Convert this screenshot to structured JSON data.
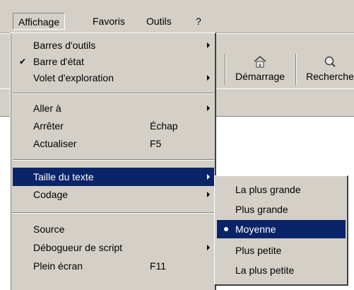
{
  "menubar": {
    "items": [
      {
        "label": "Affichage",
        "active": true
      },
      {
        "label": "Favoris"
      },
      {
        "label": "Outils"
      },
      {
        "label": "?"
      }
    ]
  },
  "toolbar": {
    "home_label": "Démarrage",
    "search_label": "Recherche",
    "home_icon": "home-icon",
    "search_icon": "search-icon"
  },
  "view_menu": {
    "items": [
      {
        "label": "Barres d'outils",
        "submenu": true
      },
      {
        "label": "Barre d'état",
        "checked": true
      },
      {
        "label": "Volet d'exploration",
        "submenu": true
      },
      {
        "label": "Aller à",
        "submenu": true
      },
      {
        "label": "Arrêter",
        "shortcut": "Échap"
      },
      {
        "label": "Actualiser",
        "shortcut": "F5"
      },
      {
        "label": "Taille du texte",
        "submenu": true,
        "highlighted": true
      },
      {
        "label": "Codage",
        "submenu": true
      },
      {
        "label": "Source"
      },
      {
        "label": "Débogueur de script",
        "submenu": true
      },
      {
        "label": "Plein écran",
        "shortcut": "F11"
      }
    ]
  },
  "text_size_submenu": {
    "items": [
      {
        "label": "La plus grande"
      },
      {
        "label": "Plus grande"
      },
      {
        "label": "Moyenne",
        "selected": true
      },
      {
        "label": "Plus petite"
      },
      {
        "label": "La plus petite"
      }
    ]
  },
  "colors": {
    "chrome": "#d4d0c8",
    "highlight": "#0a246a",
    "highlight_text": "#ffffff"
  }
}
